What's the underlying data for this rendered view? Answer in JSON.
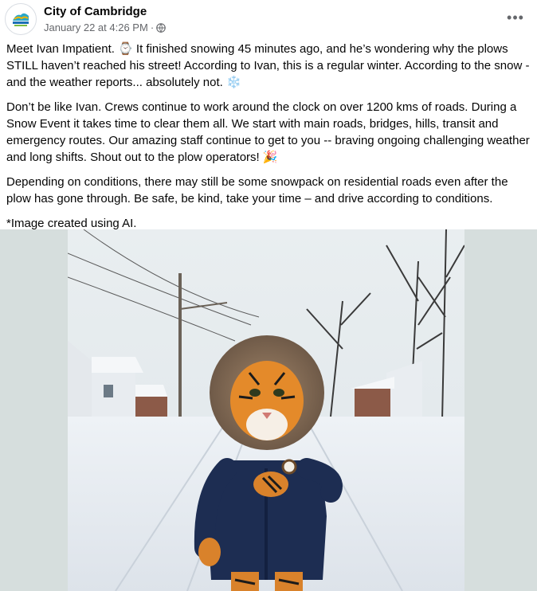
{
  "post": {
    "page_name": "City of Cambridge",
    "timestamp": "January 22 at 4:26 PM",
    "separator": "·",
    "privacy_icon": "globe-icon",
    "more_label": "•••",
    "paragraphs": {
      "p1": "Meet Ivan Impatient. ⌚ It finished snowing 45 minutes ago, and he’s wondering why the plows STILL haven’t reached his street! According to Ivan, this is a regular winter. According to the snow - and the weather reports... absolutely not. ❄️",
      "p2": "Don’t be like Ivan. Crews continue to work around the clock on over 1200 kms of roads. During a Snow Event it takes time to clear them all. We start with main roads, bridges, hills, transit and emergency routes. Our amazing staff continue to get to you -- braving ongoing challenging weather and long shifts. Shout out to the plow operators! 🎉",
      "p3": "Depending on conditions, there may still be some snowpack on residential roads even after the plow has gone through. Be safe, be kind, take your time – and drive according to conditions.",
      "p4": "*Image created using AI."
    }
  },
  "colors": {
    "secondary_text": "#65676b",
    "photo_background": "#d6dedd"
  }
}
